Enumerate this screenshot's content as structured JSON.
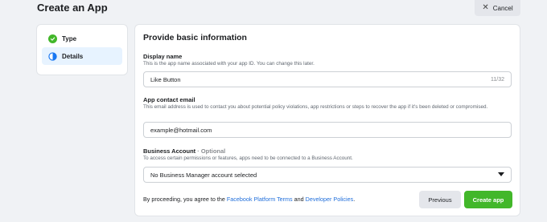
{
  "header": {
    "title": "Create an App",
    "cancel_label": "Cancel"
  },
  "steps": [
    {
      "label": "Type",
      "state": "complete",
      "icon": "check-circle-icon"
    },
    {
      "label": "Details",
      "state": "active",
      "icon": "half-circle-icon"
    }
  ],
  "form": {
    "title": "Provide basic information",
    "display_name": {
      "label": "Display name",
      "help": "This is the app name associated with your app ID. You can change this later.",
      "value": "Like Button",
      "counter": "11/32"
    },
    "contact_email": {
      "label": "App contact email",
      "help": "This email address is used to contact you about potential policy violations, app restrictions or steps to recover the app if it's been deleted or compromised.",
      "value": "example@hotmail.com"
    },
    "business_account": {
      "label": "Business Account",
      "optional": " · Optional",
      "help": "To access certain permissions or features, apps need to be connected to a Business Account.",
      "selected": "No Business Manager account selected"
    },
    "terms": {
      "prefix": "By proceeding, you agree to the ",
      "link1": "Facebook Platform Terms",
      "middle": " and ",
      "link2": "Developer Policies",
      "suffix": "."
    },
    "previous_label": "Previous",
    "create_label": "Create app"
  },
  "colors": {
    "accent_green": "#42b72a",
    "link_blue": "#216fdb",
    "active_step_bg": "#e7f3ff"
  }
}
